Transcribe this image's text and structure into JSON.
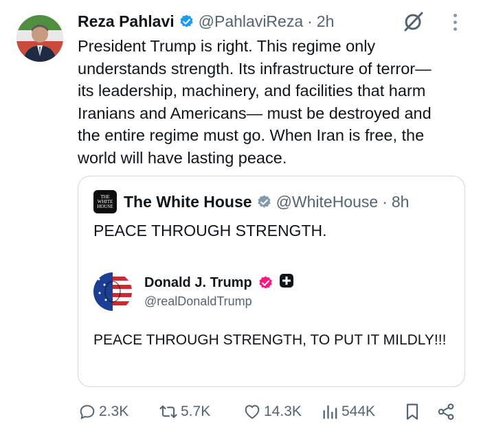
{
  "tweet": {
    "author_name": "Reza Pahlavi",
    "handle": "@PahlaviReza",
    "separator": "·",
    "time": "2h",
    "text": "President Trump is right. This regime only\nunderstands strength. Its infrastructure of terror—\nits leadership, machinery, and facilities that harm\nIranians and Americans— must be destroyed and\nthe entire regime must go. When Iran is free, the\nworld will have lasting peace."
  },
  "quote": {
    "author_name": "The White House",
    "logo_text": [
      "THE",
      "WHITE",
      "HOUSE"
    ],
    "handle": "@WhiteHouse",
    "separator": "·",
    "time": "8h",
    "text": "PEACE THROUGH STRENGTH.",
    "nested": {
      "author_name": "Donald J. Trump",
      "handle": "@realDonaldTrump",
      "text": "PEACE THROUGH STRENGTH, TO PUT IT MILDLY!!!"
    }
  },
  "actions": {
    "replies": "2.3K",
    "reposts": "5.7K",
    "likes": "14.3K",
    "views": "544K"
  },
  "colors": {
    "verified_blue": "#1d9bf0",
    "verified_gray": "#829aab",
    "verified_pink": "#f91880",
    "muted_text": "#536471",
    "border": "#cfd9de"
  },
  "icons": [
    "verified-badge-icon",
    "grok-icon",
    "more-icon",
    "reply-icon",
    "repost-icon",
    "like-icon",
    "views-icon",
    "bookmark-icon",
    "share-icon",
    "gov-badge-icon"
  ]
}
